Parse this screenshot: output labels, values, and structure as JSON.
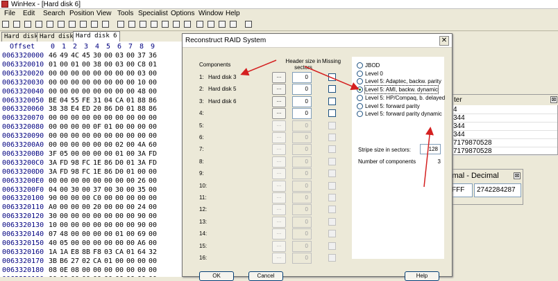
{
  "app": {
    "title": "WinHex - [Hard disk 6]",
    "accent": "#c03030"
  },
  "menu": [
    "File",
    "Edit",
    "Search",
    "Position",
    "View",
    "Tools",
    "Specialist",
    "Options",
    "Window",
    "Help"
  ],
  "toolbar_icons": [
    "new-icon",
    "open-icon",
    "save-icon",
    "print-icon",
    "properties-icon",
    "undo-icon",
    "cut-icon",
    "copy-icon",
    "paste-icon",
    "paste-special-icon",
    "find-text-icon",
    "find-hex-icon",
    "replace-text-icon",
    "replace-hex-icon",
    "goto-offset-icon",
    "goto-page-icon",
    "search-icon",
    "back-icon",
    "forward-icon",
    "bookmark-icon",
    "sector-icon",
    "book-icon"
  ],
  "tabs": [
    "Hard disk 3",
    "Hard disk 5",
    "Hard disk 6"
  ],
  "hex": {
    "offset_header": "Offset",
    "columns": [
      "0",
      "1",
      "2",
      "3",
      "4",
      "5",
      "6",
      "7",
      "8",
      "9"
    ],
    "rows": [
      {
        "offset": "0063320000",
        "bytes": [
          "46",
          "49",
          "4C",
          "45",
          "30",
          "00",
          "03",
          "00",
          "37",
          "36"
        ]
      },
      {
        "offset": "0063320010",
        "bytes": [
          "01",
          "00",
          "01",
          "00",
          "38",
          "00",
          "03",
          "00",
          "C8",
          "01"
        ]
      },
      {
        "offset": "0063320020",
        "bytes": [
          "00",
          "00",
          "00",
          "00",
          "00",
          "00",
          "00",
          "00",
          "03",
          "00"
        ]
      },
      {
        "offset": "0063320030",
        "bytes": [
          "00",
          "00",
          "00",
          "00",
          "00",
          "00",
          "00",
          "00",
          "10",
          "00"
        ]
      },
      {
        "offset": "0063320040",
        "bytes": [
          "00",
          "00",
          "00",
          "00",
          "00",
          "00",
          "00",
          "00",
          "48",
          "00"
        ]
      },
      {
        "offset": "0063320050",
        "bytes": [
          "BE",
          "04",
          "55",
          "FE",
          "31",
          "04",
          "CA",
          "01",
          "88",
          "86"
        ]
      },
      {
        "offset": "0063320060",
        "bytes": [
          "38",
          "38",
          "E4",
          "ED",
          "20",
          "86",
          "D0",
          "01",
          "88",
          "86"
        ]
      },
      {
        "offset": "0063320070",
        "bytes": [
          "00",
          "00",
          "00",
          "00",
          "00",
          "00",
          "00",
          "00",
          "00",
          "00"
        ]
      },
      {
        "offset": "0063320080",
        "bytes": [
          "00",
          "00",
          "00",
          "00",
          "0F",
          "01",
          "00",
          "00",
          "00",
          "00"
        ]
      },
      {
        "offset": "0063320090",
        "bytes": [
          "00",
          "00",
          "00",
          "00",
          "00",
          "00",
          "00",
          "00",
          "00",
          "00"
        ]
      },
      {
        "offset": "00633200A0",
        "bytes": [
          "00",
          "00",
          "00",
          "00",
          "00",
          "00",
          "02",
          "00",
          "4A",
          "60"
        ]
      },
      {
        "offset": "00633200B0",
        "bytes": [
          "3F",
          "05",
          "00",
          "00",
          "00",
          "00",
          "01",
          "00",
          "3A",
          "FD"
        ]
      },
      {
        "offset": "00633200C0",
        "bytes": [
          "3A",
          "FD",
          "98",
          "FC",
          "1E",
          "86",
          "D0",
          "01",
          "3A",
          "FD"
        ]
      },
      {
        "offset": "00633200D0",
        "bytes": [
          "3A",
          "FD",
          "98",
          "FC",
          "1E",
          "86",
          "D0",
          "01",
          "00",
          "00"
        ]
      },
      {
        "offset": "00633200E0",
        "bytes": [
          "00",
          "00",
          "00",
          "00",
          "00",
          "00",
          "00",
          "00",
          "26",
          "00"
        ]
      },
      {
        "offset": "00633200F0",
        "bytes": [
          "04",
          "00",
          "30",
          "00",
          "37",
          "00",
          "30",
          "00",
          "35",
          "00"
        ]
      },
      {
        "offset": "0063320100",
        "bytes": [
          "90",
          "00",
          "00",
          "00",
          "C0",
          "00",
          "00",
          "00",
          "00",
          "00"
        ]
      },
      {
        "offset": "0063320110",
        "bytes": [
          "A0",
          "00",
          "00",
          "00",
          "20",
          "00",
          "00",
          "00",
          "24",
          "00"
        ]
      },
      {
        "offset": "0063320120",
        "bytes": [
          "30",
          "00",
          "00",
          "00",
          "00",
          "00",
          "00",
          "00",
          "90",
          "00"
        ]
      },
      {
        "offset": "0063320130",
        "bytes": [
          "10",
          "00",
          "00",
          "00",
          "00",
          "00",
          "00",
          "00",
          "90",
          "00"
        ]
      },
      {
        "offset": "0063320140",
        "bytes": [
          "07",
          "48",
          "00",
          "00",
          "00",
          "00",
          "01",
          "00",
          "69",
          "00"
        ]
      },
      {
        "offset": "0063320150",
        "bytes": [
          "40",
          "05",
          "00",
          "00",
          "00",
          "00",
          "00",
          "00",
          "A6",
          "00"
        ]
      },
      {
        "offset": "0063320160",
        "bytes": [
          "1A",
          "1A",
          "E8",
          "8B",
          "F8",
          "03",
          "CA",
          "01",
          "64",
          "32"
        ]
      },
      {
        "offset": "0063320170",
        "bytes": [
          "3B",
          "B6",
          "27",
          "02",
          "CA",
          "01",
          "00",
          "00",
          "00",
          "00"
        ]
      },
      {
        "offset": "0063320180",
        "bytes": [
          "08",
          "0E",
          "08",
          "00",
          "00",
          "00",
          "00",
          "00",
          "00",
          "00"
        ]
      },
      {
        "offset": "0063320190",
        "bytes": [
          "00",
          "00",
          "00",
          "00",
          "00",
          "00",
          "00",
          "00",
          "00",
          "00"
        ]
      }
    ]
  },
  "side_panel": {
    "title_fragment": "ter",
    "close_glyph": "⊠",
    "rows": [
      "4",
      "344",
      "344",
      "344",
      "7179870528",
      "7179870528"
    ]
  },
  "convert_panel": {
    "title_fragment": "imal - Decimal",
    "close_glyph": "⊠",
    "hex_value": "FFF",
    "dec_value": "2742284287"
  },
  "dialog": {
    "title": "Reconstruct RAID System",
    "close_glyph": "✕",
    "components_label": "Components",
    "header_size_label": "Header size in sectors",
    "missing_label": "Missing",
    "browse_label": "...",
    "components": [
      {
        "num": "1:",
        "name": "Hard disk 3",
        "header": "0",
        "enabled": true
      },
      {
        "num": "2:",
        "name": "Hard disk 5",
        "header": "0",
        "enabled": true
      },
      {
        "num": "3:",
        "name": "Hard disk 6",
        "header": "0",
        "enabled": true
      },
      {
        "num": "4:",
        "name": "",
        "header": "0",
        "enabled": true
      },
      {
        "num": "5:",
        "name": "",
        "header": "0",
        "enabled": false
      },
      {
        "num": "6:",
        "name": "",
        "header": "0",
        "enabled": false
      },
      {
        "num": "7:",
        "name": "",
        "header": "0",
        "enabled": false
      },
      {
        "num": "8:",
        "name": "",
        "header": "0",
        "enabled": false
      },
      {
        "num": "9:",
        "name": "",
        "header": "0",
        "enabled": false
      },
      {
        "num": "10:",
        "name": "",
        "header": "0",
        "enabled": false
      },
      {
        "num": "11:",
        "name": "",
        "header": "0",
        "enabled": false
      },
      {
        "num": "12:",
        "name": "",
        "header": "0",
        "enabled": false
      },
      {
        "num": "13:",
        "name": "",
        "header": "0",
        "enabled": false
      },
      {
        "num": "14:",
        "name": "",
        "header": "0",
        "enabled": false
      },
      {
        "num": "15:",
        "name": "",
        "header": "0",
        "enabled": false
      },
      {
        "num": "16:",
        "name": "",
        "header": "0",
        "enabled": false
      }
    ],
    "levels": [
      {
        "label": "JBOD",
        "checked": false
      },
      {
        "label": "Level 0",
        "checked": false
      },
      {
        "label": "Level 5: Adaptec, backw. parity",
        "checked": false
      },
      {
        "label": "Level 5: AMI, backw. dynamic",
        "checked": true
      },
      {
        "label": "Level 5: HP/Compaq, b. delayed",
        "checked": false
      },
      {
        "label": "Level 5: forward parity",
        "checked": false
      },
      {
        "label": "Level 5: forward parity dynamic",
        "checked": false
      }
    ],
    "stripe_label": "Stripe size in sectors:",
    "stripe_value": "128",
    "num_components_label": "Number of components",
    "num_components_value": "3",
    "buttons": [
      "OK",
      "Cancel",
      "Help"
    ],
    "annotation_color": "#d42020"
  }
}
